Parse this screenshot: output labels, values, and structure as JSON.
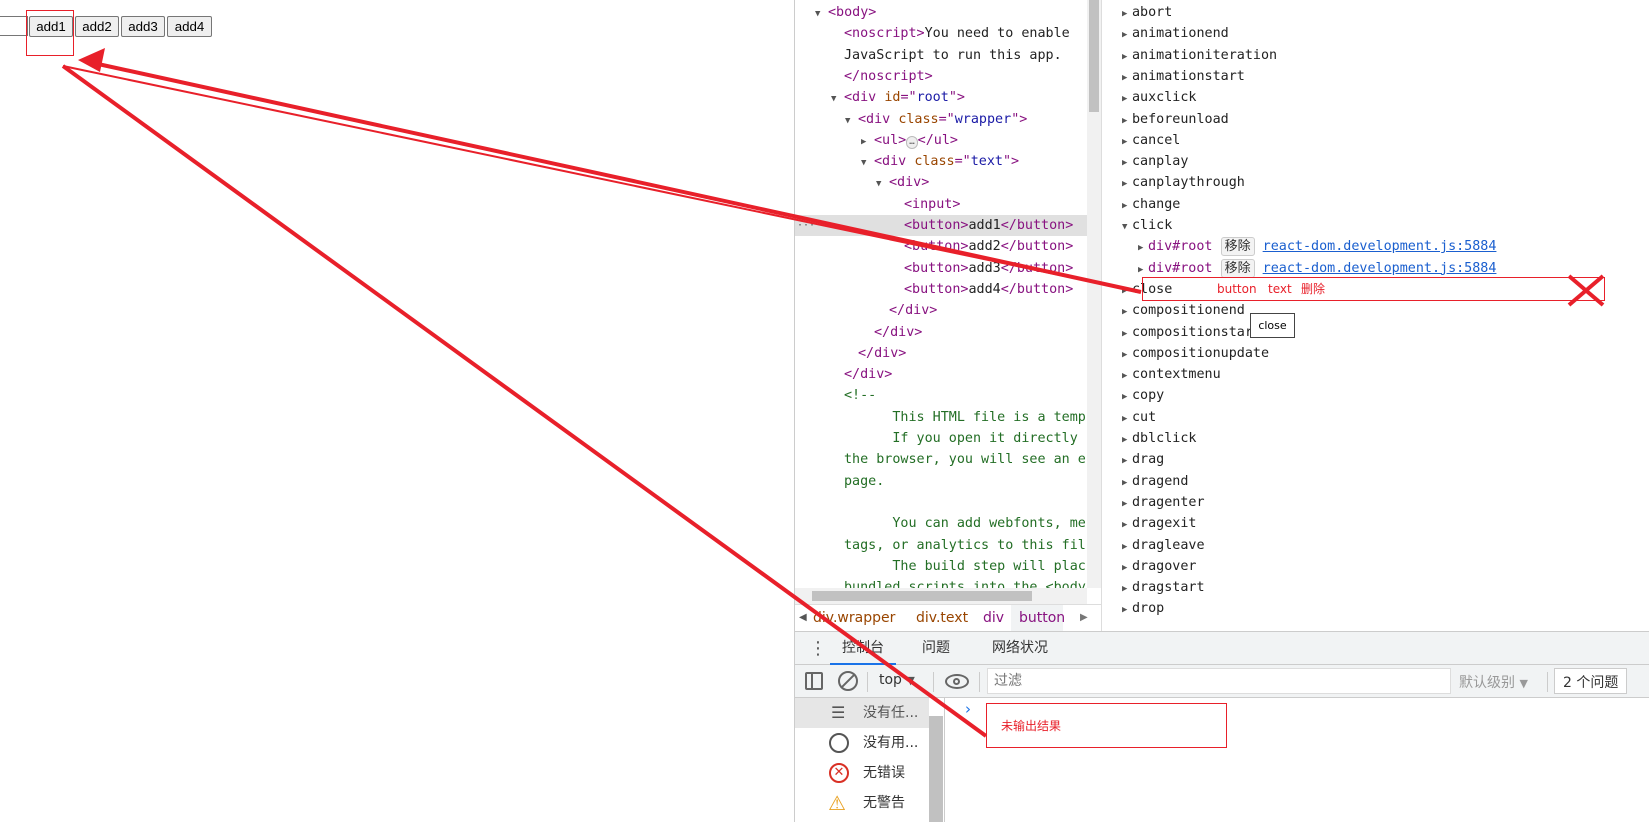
{
  "page": {
    "buttons": [
      "add1",
      "add2",
      "add3",
      "add4"
    ]
  },
  "elements": {
    "lines": [
      {
        "parts": [
          [
            "tag",
            "<body>"
          ]
        ]
      },
      {
        "parts": [
          [
            "tag",
            "<noscript>"
          ],
          [
            "txt",
            "You need to enable"
          ]
        ]
      },
      {
        "parts": [
          [
            "txt",
            "JavaScript to run this app."
          ]
        ]
      },
      {
        "parts": [
          [
            "tag",
            "</noscript>"
          ]
        ]
      },
      {
        "parts": [
          [
            "tag",
            "<div "
          ],
          [
            "attr",
            "id"
          ],
          [
            "tag",
            "=\""
          ],
          [
            "val",
            "root"
          ],
          [
            "tag",
            "\">"
          ]
        ]
      },
      {
        "parts": [
          [
            "tag",
            "<div "
          ],
          [
            "attr",
            "class"
          ],
          [
            "tag",
            "=\""
          ],
          [
            "val",
            "wrapper"
          ],
          [
            "tag",
            "\">"
          ]
        ]
      },
      {
        "parts": [
          [
            "tag",
            "<ul>"
          ],
          [
            "ell",
            "…"
          ],
          [
            "tag",
            "</ul>"
          ]
        ]
      },
      {
        "parts": [
          [
            "tag",
            "<div "
          ],
          [
            "attr",
            "class"
          ],
          [
            "tag",
            "=\""
          ],
          [
            "val",
            "text"
          ],
          [
            "tag",
            "\">"
          ]
        ]
      },
      {
        "parts": [
          [
            "tag",
            "<div>"
          ]
        ]
      },
      {
        "parts": [
          [
            "tag",
            "<input>"
          ]
        ]
      },
      {
        "parts": [
          [
            "tag",
            "<button>"
          ],
          [
            "txt",
            "add1"
          ],
          [
            "tag",
            "</button>"
          ]
        ]
      },
      {
        "parts": [
          [
            "tag",
            "<button>"
          ],
          [
            "txt",
            "add2"
          ],
          [
            "tag",
            "</button>"
          ]
        ]
      },
      {
        "parts": [
          [
            "tag",
            "<button>"
          ],
          [
            "txt",
            "add3"
          ],
          [
            "tag",
            "</button>"
          ]
        ]
      },
      {
        "parts": [
          [
            "tag",
            "<button>"
          ],
          [
            "txt",
            "add4"
          ],
          [
            "tag",
            "</button>"
          ]
        ]
      },
      {
        "parts": [
          [
            "tag",
            "</div>"
          ]
        ]
      },
      {
        "parts": [
          [
            "tag",
            "</div>"
          ]
        ]
      },
      {
        "parts": [
          [
            "tag",
            "</div>"
          ]
        ]
      },
      {
        "parts": [
          [
            "tag",
            "</div>"
          ]
        ]
      },
      {
        "parts": [
          [
            "cmt",
            "<!--"
          ]
        ]
      },
      {
        "parts": [
          [
            "cmt",
            "      This HTML file is a temp"
          ]
        ]
      },
      {
        "parts": [
          [
            "cmt",
            "      If you open it directly"
          ]
        ]
      },
      {
        "parts": [
          [
            "cmt",
            "the browser, you will see an e"
          ]
        ]
      },
      {
        "parts": [
          [
            "cmt",
            "page."
          ]
        ]
      },
      {
        "parts": [
          [
            "cmt",
            ""
          ]
        ]
      },
      {
        "parts": [
          [
            "cmt",
            "      You can add webfonts, me"
          ]
        ]
      },
      {
        "parts": [
          [
            "cmt",
            "tags, or analytics to this fil"
          ]
        ]
      },
      {
        "parts": [
          [
            "cmt",
            "      The build step will plac"
          ]
        ]
      },
      {
        "parts": [
          [
            "cmt",
            "bundled scripts into the <body"
          ]
        ]
      }
    ],
    "breadcrumb": [
      "div.wrapper",
      "div.text",
      "div",
      "button"
    ]
  },
  "listeners": {
    "events_before": [
      "abort",
      "animationend",
      "animationiteration",
      "animationstart",
      "auxclick",
      "beforeunload",
      "cancel",
      "canplay",
      "canplaythrough",
      "change",
      "click"
    ],
    "click_entries": [
      {
        "node": "div#root",
        "remove": "移除",
        "source": "react-dom.development.js:5884"
      },
      {
        "node": "div#root",
        "remove": "移除",
        "source": "react-dom.development.js:5884"
      }
    ],
    "events_after": [
      "close",
      "compositionend",
      "compositionstart",
      "compositionupdate",
      "contextmenu",
      "copy",
      "cut",
      "dblclick",
      "drag",
      "dragend",
      "dragenter",
      "dragexit",
      "dragleave",
      "dragover",
      "dragstart",
      "drop"
    ],
    "tooltip": "close"
  },
  "console": {
    "tabs": [
      "控制台",
      "问题",
      "网络状况"
    ],
    "context": "top",
    "filter_placeholder": "过滤",
    "level": "默认级别",
    "issues": "2 个问题",
    "sidebar": [
      "没有任...",
      "没有用...",
      "无错误",
      "无警告"
    ]
  },
  "annotations": {
    "row_note": [
      "button",
      "text",
      "删除"
    ],
    "console_note": "未输出结果",
    "color": "#e8202a"
  }
}
